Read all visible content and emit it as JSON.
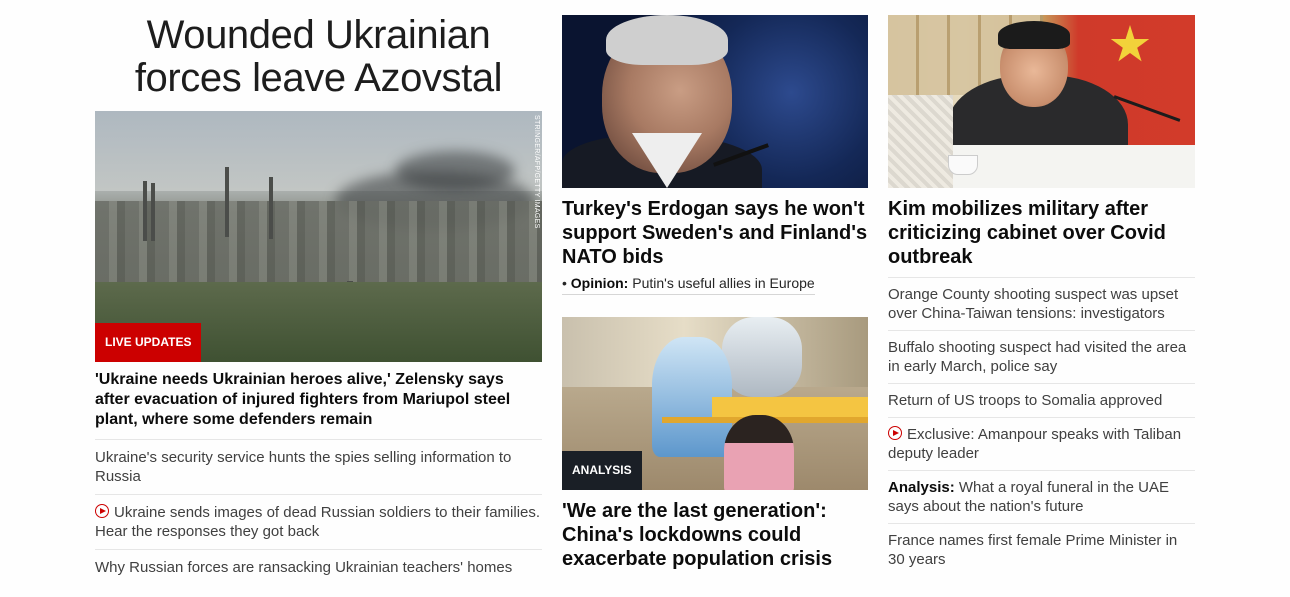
{
  "col1": {
    "title": "Wounded Ukrainian forces leave Azovstal",
    "hero_credit": "STRINGER/AFP/GETTY IMAGES",
    "badge": "LIVE UPDATES",
    "lead": "'Ukraine needs Ukrainian heroes alive,' Zelensky says after evacuation of injured fighters from Mariupol steel plant, where some defenders remain",
    "items": [
      {
        "text": "Ukraine's security service hunts the spies selling information to Russia",
        "video": false
      },
      {
        "text": "Ukraine sends images of dead Russian soldiers to their families. Hear the responses they got back",
        "video": true
      },
      {
        "text": "Why Russian forces are ransacking Ukrainian teachers' homes",
        "video": false
      }
    ]
  },
  "col2": {
    "story1": {
      "headline": "Turkey's Erdogan says he won't support Sweden's and Finland's NATO bids",
      "opinion_label": "Opinion:",
      "opinion_text": "Putin's useful allies in Europe"
    },
    "story2": {
      "badge": "ANALYSIS",
      "headline": "'We are the last generation': China's lockdowns could exacerbate population crisis"
    }
  },
  "col3": {
    "headline": "Kim mobilizes military after criticizing cabinet over Covid outbreak",
    "items": [
      {
        "prefix": "",
        "text": "Orange County shooting suspect was upset over China-Taiwan tensions: investigators",
        "video": false
      },
      {
        "prefix": "",
        "text": "Buffalo shooting suspect had visited the area in early March, police say",
        "video": false
      },
      {
        "prefix": "",
        "text": "Return of US troops to Somalia approved",
        "video": false
      },
      {
        "prefix": "",
        "text": "Exclusive: Amanpour speaks with Taliban deputy leader",
        "video": true
      },
      {
        "prefix": "Analysis:",
        "text": "What a royal funeral in the UAE says about the nation's future",
        "video": false
      },
      {
        "prefix": "",
        "text": "France names first female Prime Minister in 30 years",
        "video": false
      }
    ]
  },
  "colors": {
    "live_red": "#cc0000",
    "analysis_badge": "#1a1f26",
    "divider": "#e6e6e6"
  },
  "icons": {
    "video": "play-circle-icon"
  }
}
